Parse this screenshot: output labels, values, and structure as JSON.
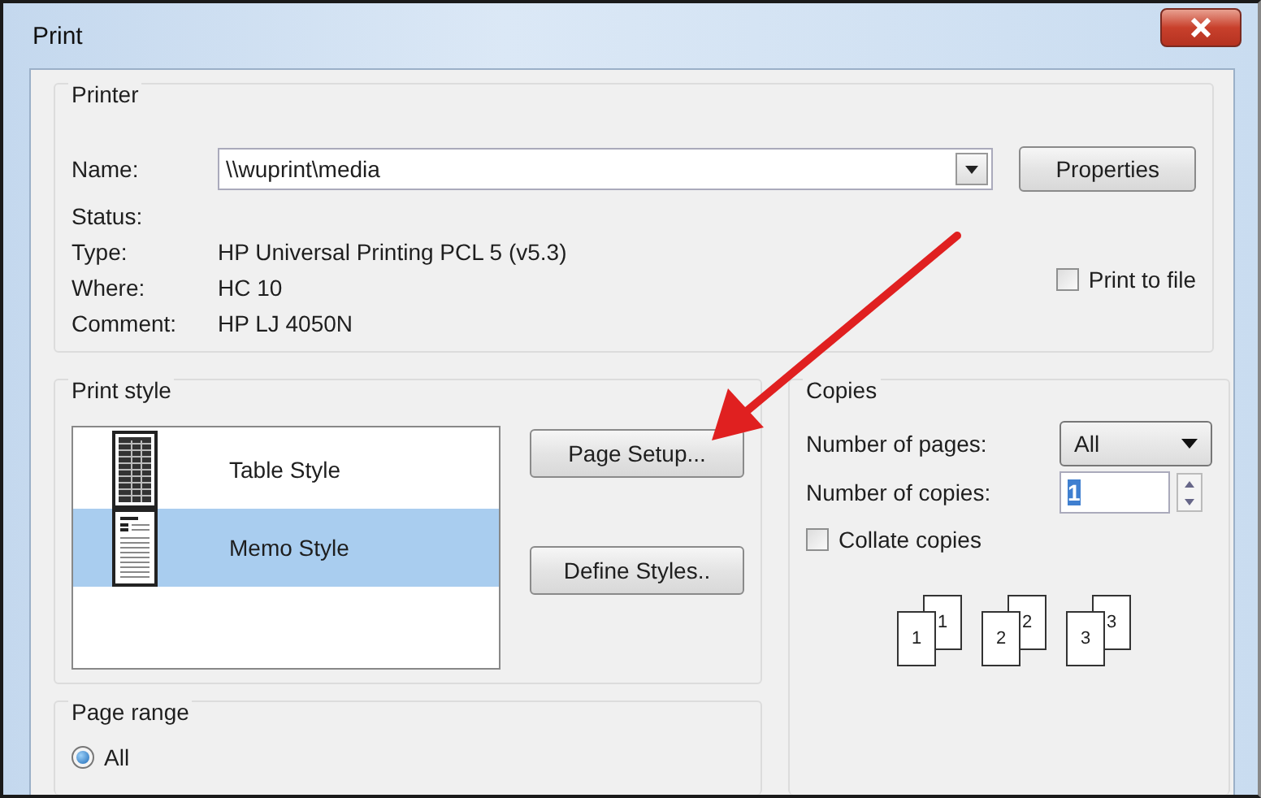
{
  "window": {
    "title": "Print"
  },
  "printer": {
    "title": "Printer",
    "name_label": "Name:",
    "name_value": "\\\\wuprint\\media",
    "properties_button": "Properties",
    "info": [
      {
        "label": "Status:"
      },
      {
        "label": "Type:",
        "value": "HP Universal Printing PCL 5 (v5.3)"
      },
      {
        "label": "Where:",
        "value": "HC 10"
      },
      {
        "label": "Comment:",
        "value": "HP LJ 4050N"
      }
    ],
    "print_to_file": {
      "label": "Print to file",
      "checked": false
    }
  },
  "print_style": {
    "title": "Print style",
    "items": [
      {
        "label": "Table Style",
        "kind": "table",
        "selected": false
      },
      {
        "label": "Memo Style",
        "kind": "memo",
        "selected": true
      }
    ],
    "buttons": [
      "Page Setup...",
      "Define Styles.."
    ]
  },
  "copies": {
    "title": "Copies",
    "pages_label": "Number of pages:",
    "pages_value": "All",
    "copies_label": "Number of copies:",
    "copies_value": "1",
    "collate": {
      "label": "Collate copies",
      "checked": false
    },
    "sets": [
      {
        "back": "1",
        "front": "1"
      },
      {
        "back": "2",
        "front": "2"
      },
      {
        "back": "3",
        "front": "3"
      }
    ]
  },
  "page_range": {
    "title": "Page range",
    "options": [
      {
        "label": "All",
        "selected": true
      }
    ]
  }
}
